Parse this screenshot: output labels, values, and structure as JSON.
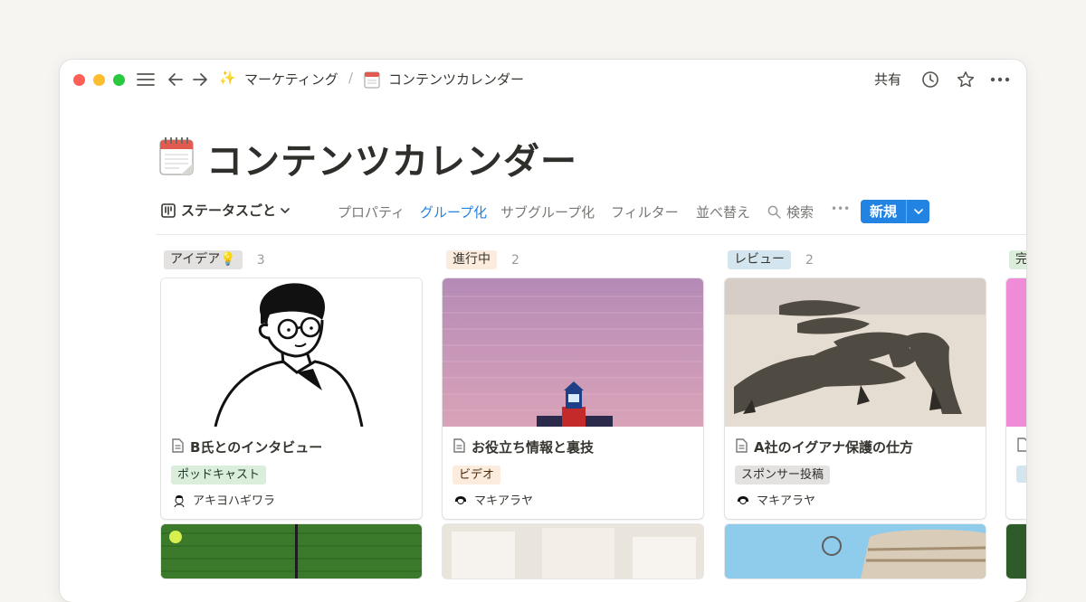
{
  "breadcrumb": {
    "workspace_emoji": "✨",
    "workspace": "マーケティング",
    "separator": "/",
    "page_emoji": "🗓️",
    "page": "コンテンツカレンダー"
  },
  "topbar": {
    "share_label": "共有",
    "icons": [
      "sidebar-menu-icon",
      "back-arrow-icon",
      "forward-arrow-icon",
      "clock-icon",
      "star-icon",
      "more-icon"
    ]
  },
  "page": {
    "emoji": "🗓️",
    "title": "コンテンツカレンダー"
  },
  "viewbar": {
    "view_name": "ステータスごと",
    "properties": "プロパティ",
    "group": "グループ化",
    "subgroup": "サブグループ化",
    "filter": "フィルター",
    "sort": "並べ替え",
    "search": "検索",
    "more": "•••",
    "new_label": "新規",
    "accent_color": "#2383e2"
  },
  "columns": [
    {
      "name": "アイデア💡",
      "count": "3",
      "tag_bg": "#e3e2e0",
      "card": {
        "title": "B氏とのインタビュー",
        "tag": "ポッドキャスト",
        "tag_bg": "#dbeddb",
        "tag_color": "#1c3829",
        "person": "アキヨハギワラ",
        "cover": "line-drawing-man-with-glasses"
      }
    },
    {
      "name": "進行中",
      "count": "2",
      "tag_bg": "#fbecdd",
      "card": {
        "title": "お役立ち情報と裏技",
        "tag": "ビデオ",
        "tag_bg": "#fbecdd",
        "tag_color": "#49290e",
        "person": "マキアラヤ",
        "cover": "pink-sea-with-lighthouse"
      }
    },
    {
      "name": "レビュー",
      "count": "2",
      "tag_bg": "#d3e5ef",
      "card": {
        "title": "A社のイグアナ保護の仕方",
        "tag": "スポンサー投稿",
        "tag_bg": "#e3e2e0",
        "tag_color": "#32302c",
        "person": "マキアラヤ",
        "cover": "iguanas-on-sand"
      }
    },
    {
      "name": "完",
      "tag_bg": "#dbeddb"
    }
  ]
}
